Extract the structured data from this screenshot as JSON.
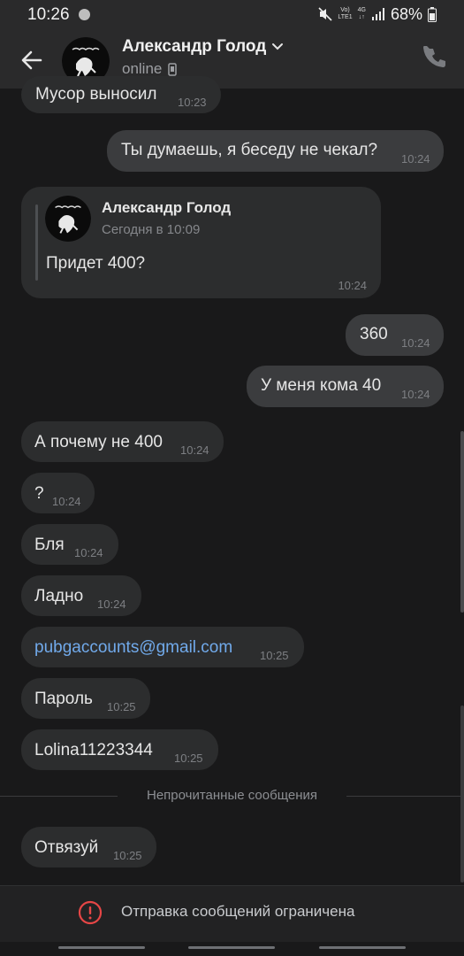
{
  "status_bar": {
    "time": "10:26",
    "net_top": "Vo)",
    "net_bottom": "LTE1",
    "net_gen": "4G",
    "battery": "68%"
  },
  "header": {
    "name": "Александр Голод",
    "status": "online"
  },
  "messages": [
    {
      "dir": "in",
      "text": "Мусор выносил",
      "time": "10:23"
    },
    {
      "dir": "out",
      "text": "Ты думаешь, я беседу не чекал?",
      "time": "10:24"
    },
    {
      "dir": "out",
      "text": "360",
      "time": "10:24"
    },
    {
      "dir": "out",
      "text": "У меня кома 40",
      "time": "10:24"
    },
    {
      "dir": "in",
      "text": "А почему не 400",
      "time": "10:24"
    },
    {
      "dir": "in",
      "text": "?",
      "time": "10:24"
    },
    {
      "dir": "in",
      "text": "Бля",
      "time": "10:24"
    },
    {
      "dir": "in",
      "text": "Ладно",
      "time": "10:24"
    },
    {
      "dir": "in",
      "text": "pubgaccounts@gmail.com",
      "time": "10:25"
    },
    {
      "dir": "in",
      "text": "Пароль",
      "time": "10:25"
    },
    {
      "dir": "in",
      "text": "Lolina11223344",
      "time": "10:25"
    },
    {
      "dir": "in",
      "text": "Отвязуй",
      "time": "10:25"
    }
  ],
  "reply": {
    "name": "Александр Голод",
    "date": "Сегодня в 10:09",
    "text": "Придет 400?",
    "time": "10:24"
  },
  "unread_label": "Непрочитанные сообщения",
  "restriction": "Отправка сообщений ограничена",
  "colors": {
    "accent": "#71aaeb",
    "warning": "#e64646",
    "bubble_in": "#2c2d2e",
    "bubble_out": "#3b3c3e"
  }
}
